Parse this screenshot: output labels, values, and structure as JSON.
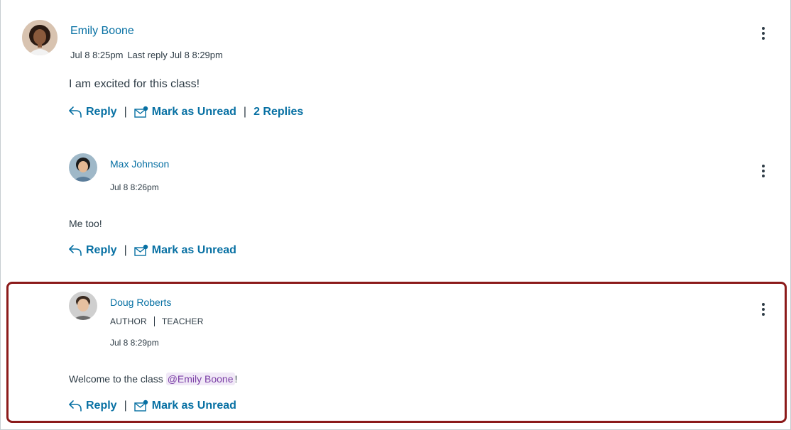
{
  "entries": [
    {
      "author": "Emily Boone",
      "posted": "Jul 8 8:25pm",
      "last_reply": "Last reply Jul 8 8:29pm",
      "message": "I am excited for this class!",
      "reply_label": "Reply",
      "mark_unread_label": "Mark as Unread",
      "replies_label": "2 Replies"
    },
    {
      "author": "Max Johnson",
      "posted": "Jul 8 8:26pm",
      "message": "Me too!",
      "reply_label": "Reply",
      "mark_unread_label": "Mark as Unread"
    },
    {
      "author": "Doug Roberts",
      "role_author": "AUTHOR",
      "role_teacher": "TEACHER",
      "posted": "Jul 8 8:29pm",
      "message_prefix": "Welcome to the class ",
      "mention": "@Emily Boone",
      "message_suffix": "!",
      "reply_label": "Reply",
      "mark_unread_label": "Mark as Unread"
    }
  ],
  "separator": "|",
  "colors": {
    "link": "#0770a3",
    "text": "#2d3b45",
    "mention_bg": "#f1e9f7",
    "mention_text": "#7b3fa6",
    "highlight_border": "#8b1a1a"
  },
  "icons": [
    "reply-arrow-icon",
    "mail-unread-icon",
    "more-options-icon"
  ]
}
